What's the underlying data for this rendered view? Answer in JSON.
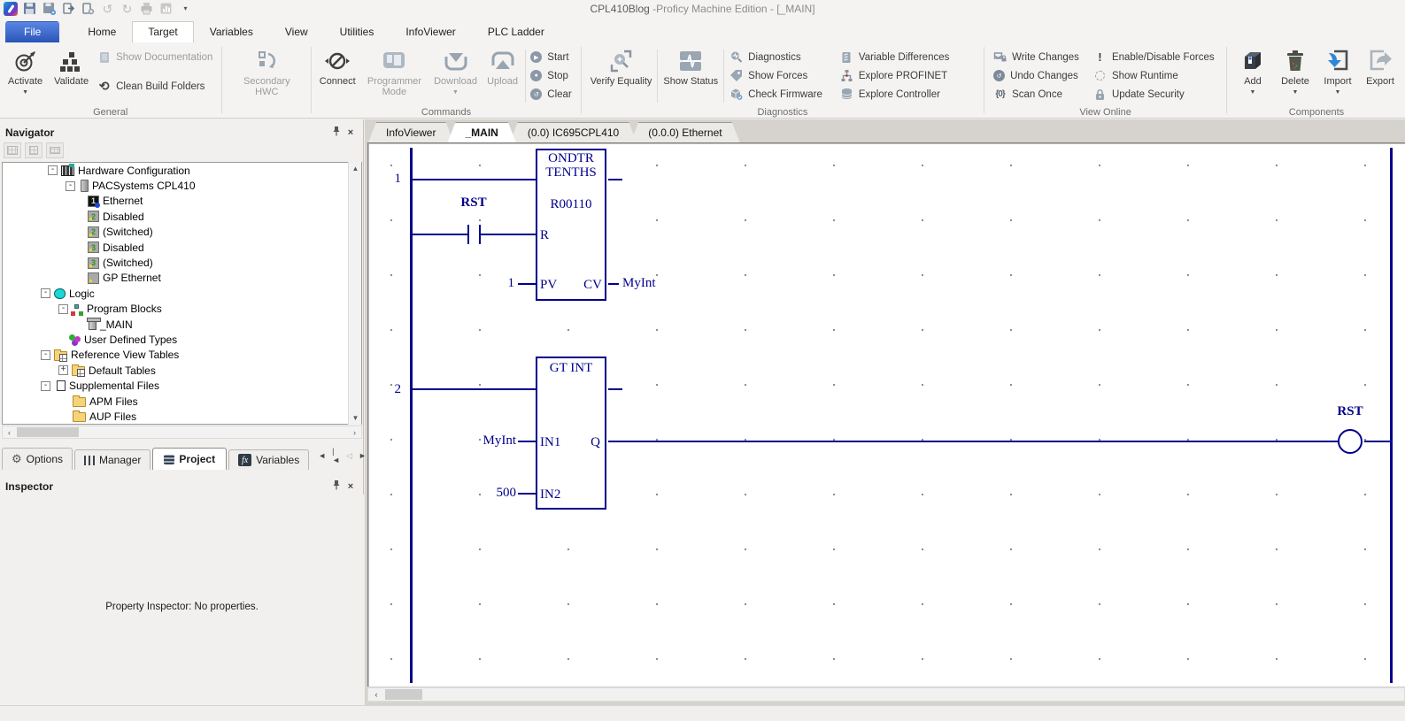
{
  "titlebar": {
    "project": "CPL410Blog",
    "title_rest": " -Proficy Machine Edition - [_MAIN]"
  },
  "qat_icons": [
    "app-logo",
    "save",
    "save-all",
    "import-project",
    "close-project",
    "undo",
    "redo",
    "print",
    "report",
    "toolbar-options"
  ],
  "ribbon_tabs": {
    "items": [
      "File",
      "Home",
      "Target",
      "Variables",
      "View",
      "Utilities",
      "InfoViewer",
      "PLC Ladder"
    ],
    "active": "Target"
  },
  "ribbon": {
    "general": {
      "label": "General",
      "activate": "Activate",
      "validate": "Validate",
      "show_documentation": "Show Documentation",
      "clean_build_folders": "Clean Build Folders"
    },
    "secondary_hwc": {
      "button": "Secondary HWC"
    },
    "commands": {
      "label": "Commands",
      "connect": "Connect",
      "programmer_mode": "Programmer Mode",
      "download": "Download",
      "upload": "Upload",
      "start": "Start",
      "stop": "Stop",
      "clear": "Clear"
    },
    "diagnostics": {
      "label": "Diagnostics",
      "verify_equality": "Verify Equality",
      "show_status": "Show Status",
      "col1": [
        "Diagnostics",
        "Show Forces",
        "Check Firmware"
      ],
      "col2": [
        "Variable Differences",
        "Explore PROFINET",
        "Explore Controller"
      ]
    },
    "view_online": {
      "label": "View Online",
      "col1": [
        "Write Changes",
        "Undo Changes",
        "Scan Once"
      ],
      "col2": [
        "Enable/Disable Forces",
        "Show Runtime",
        "Update Security"
      ]
    },
    "components": {
      "label": "Components",
      "add": "Add",
      "delete": "Delete",
      "import": "Import",
      "export": "Export"
    }
  },
  "navigator": {
    "title": "Navigator",
    "toolbar_icons": [
      "table-view",
      "diagram-view",
      "list-view"
    ],
    "tree": [
      {
        "label": "Hardware Configuration"
      },
      {
        "label": "PACSystems CPL410"
      },
      {
        "label": "Ethernet"
      },
      {
        "label": "Disabled"
      },
      {
        "label": "(Switched)"
      },
      {
        "label": "Disabled"
      },
      {
        "label": "(Switched)"
      },
      {
        "label": "GP Ethernet"
      },
      {
        "label": "Logic"
      },
      {
        "label": "Program Blocks"
      },
      {
        "label": "_MAIN"
      },
      {
        "label": "User Defined Types"
      },
      {
        "label": "Reference View Tables"
      },
      {
        "label": "Default Tables"
      },
      {
        "label": "Supplemental Files"
      },
      {
        "label": "APM Files"
      },
      {
        "label": "AUP Files"
      }
    ],
    "tabs": [
      "Options",
      "Manager",
      "Project",
      "Variables"
    ],
    "active_tab": "Project"
  },
  "inspector": {
    "title": "Inspector",
    "message": "Property Inspector: No properties."
  },
  "editor": {
    "tabs": [
      "InfoViewer",
      "_MAIN",
      "(0.0) IC695CPL410",
      "(0.0.0) Ethernet"
    ],
    "active_tab": "_MAIN"
  },
  "ladder": {
    "rung1": {
      "number": "1",
      "contact_label": "RST",
      "block_title_line1": "ONDTR",
      "block_title_line2": "TENTHS",
      "block_address": "R00110",
      "pin_r": "R",
      "pin_pv": "PV",
      "pin_cv": "CV",
      "pv_value": "1",
      "cv_output": "MyInt"
    },
    "rung2": {
      "number": "2",
      "block_title": "GT INT",
      "pin_in1": "IN1",
      "pin_in2": "IN2",
      "pin_q": "Q",
      "in1_value": "MyInt",
      "in2_value": "500",
      "coil_label": "RST"
    }
  },
  "colors": {
    "ladder": "#00008B",
    "file_tab": "#2a55b8",
    "icon_slate": "#8794a2"
  }
}
